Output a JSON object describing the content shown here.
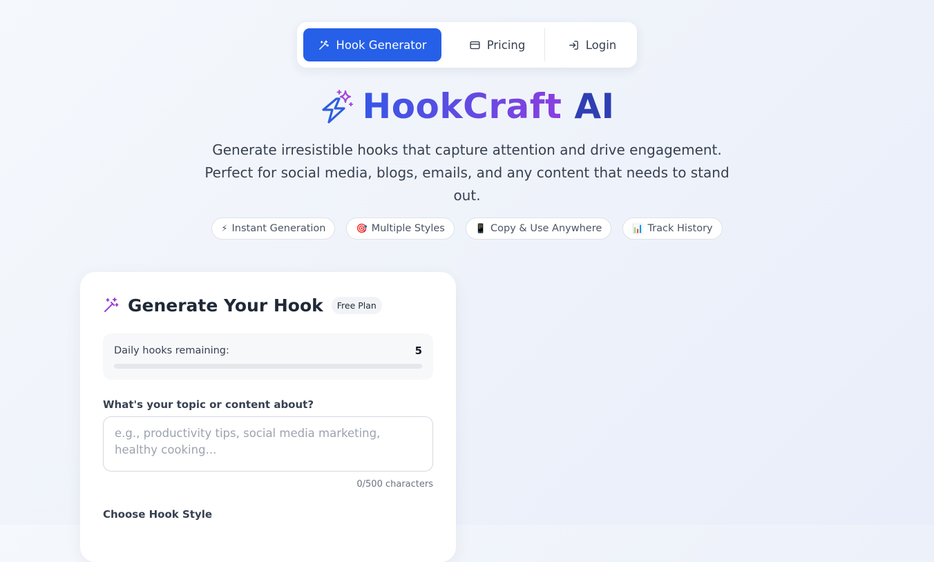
{
  "nav": {
    "items": [
      {
        "label": "Hook Generator",
        "icon": "magic-wand-icon",
        "active": true
      },
      {
        "label": "Pricing",
        "icon": "credit-card-icon",
        "active": false
      },
      {
        "label": "Login",
        "icon": "login-icon",
        "active": false
      }
    ]
  },
  "brand": {
    "icon": "lightning-sparkles-icon",
    "title_part1": "HookCraft",
    "title_part2": "AI"
  },
  "hero": {
    "subtitle": "Generate irresistible hooks that capture attention and drive engagement. Perfect for social media, blogs, emails, and any content that needs to stand out."
  },
  "features": [
    {
      "icon": "⚡",
      "label": "Instant Generation"
    },
    {
      "icon": "🎯",
      "label": "Multiple Styles"
    },
    {
      "icon": "📱",
      "label": "Copy & Use Anywhere"
    },
    {
      "icon": "📊",
      "label": "Track History"
    }
  ],
  "generator": {
    "title": "Generate Your Hook",
    "plan_badge": "Free Plan",
    "quota_label": "Daily hooks remaining:",
    "quota_value": "5",
    "quota_fill_fraction": 0,
    "topic_label": "What's your topic or content about?",
    "topic_value": "",
    "topic_placeholder": "e.g., productivity tips, social media marketing, healthy cooking...",
    "char_count": "0/500 characters",
    "style_label": "Choose Hook Style"
  },
  "colors": {
    "primary": "#2660e8",
    "brand_gradient_start": "#3557e6",
    "brand_gradient_end": "#8a3fe0",
    "brand_ai": "#2f3fb3",
    "icon_purple": "#9b3fd4"
  }
}
